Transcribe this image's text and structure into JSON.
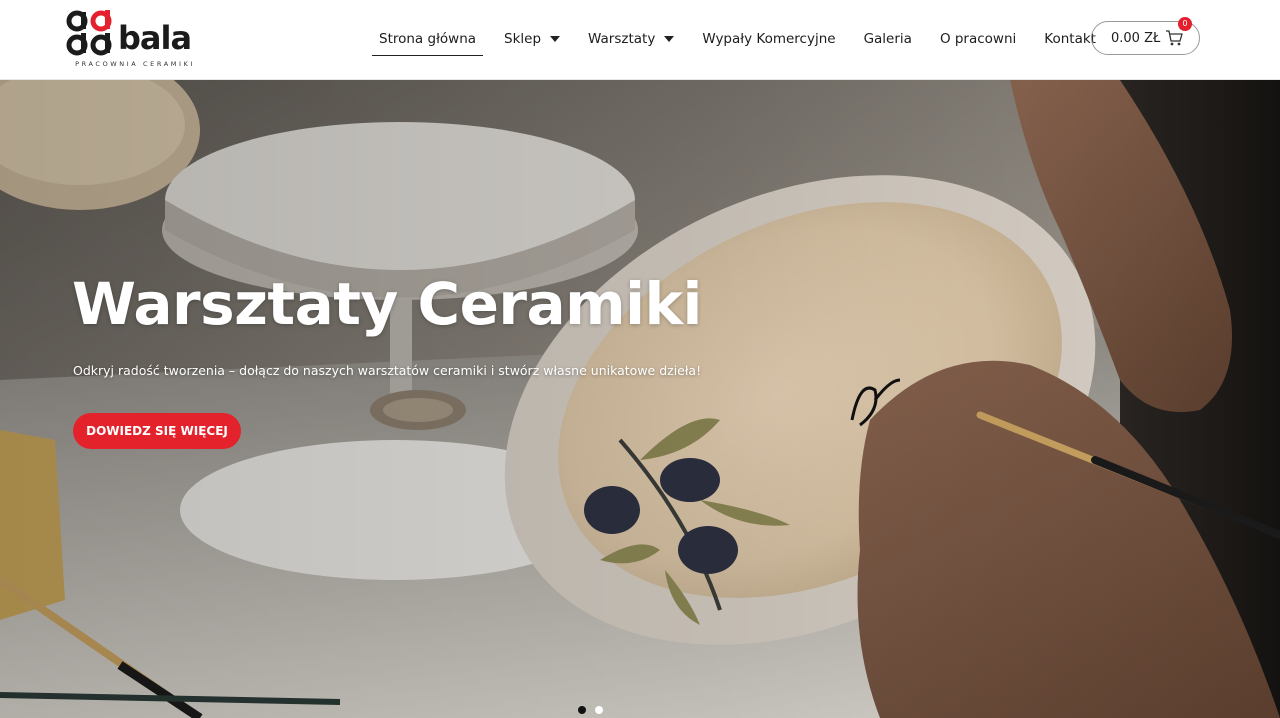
{
  "brand": {
    "name": "bala",
    "tagline": "PRACOWNIA CERAMIKI",
    "accent_color": "#e4202f",
    "dark_color": "#1b1b1b"
  },
  "nav": {
    "items": [
      {
        "label": "Strona główna",
        "active": true,
        "has_dropdown": false
      },
      {
        "label": "Sklep",
        "active": false,
        "has_dropdown": true
      },
      {
        "label": "Warsztaty",
        "active": false,
        "has_dropdown": true
      },
      {
        "label": "Wypały Komercyjne",
        "active": false,
        "has_dropdown": false
      },
      {
        "label": "Galeria",
        "active": false,
        "has_dropdown": false
      },
      {
        "label": "O pracowni",
        "active": false,
        "has_dropdown": false
      },
      {
        "label": "Kontakt",
        "active": false,
        "has_dropdown": false
      }
    ]
  },
  "cart": {
    "total": "0.00 ZŁ",
    "count": "0",
    "icon": "cart-icon"
  },
  "hero": {
    "title": "Warsztaty Ceramiki",
    "subtitle": "Odkryj radość tworzenia – dołącz do naszych warsztatów ceramiki i stwórz własne unikatowe dzieła!",
    "cta_label": "DOWIEDZ SIĘ WIĘCEJ",
    "cta_color": "#e3222c",
    "slides_total": 2,
    "slide_active": 1
  }
}
